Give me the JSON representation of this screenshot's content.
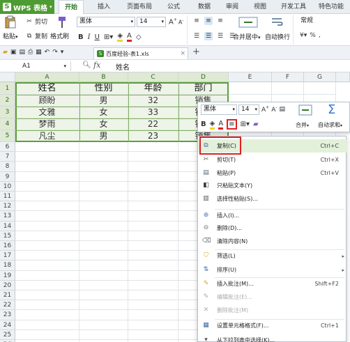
{
  "app": {
    "name": "WPS 表格",
    "logo_letter": "S"
  },
  "tabs": [
    "开始",
    "插入",
    "页面布局",
    "公式",
    "数据",
    "审阅",
    "视图",
    "开发工具",
    "特色功能"
  ],
  "active_tab": "开始",
  "ribbon": {
    "paste": "粘贴",
    "cut": "剪切",
    "copy": "复制",
    "format_painter": "格式刷",
    "font_name": "黑体",
    "font_size": "14",
    "merge": "合并居中",
    "wrap": "自动换行",
    "number_format": "常规",
    "percent": "%"
  },
  "doc_tab": "百度经验-表1.xls",
  "formula_bar": {
    "name_box": "A1",
    "fx": "fx",
    "value": "姓名"
  },
  "columns": [
    "A",
    "B",
    "C",
    "D",
    "E",
    "F",
    "G"
  ],
  "rows": [
    "1",
    "2",
    "3",
    "4",
    "5",
    "6",
    "7",
    "8",
    "9",
    "10",
    "11",
    "12",
    "13",
    "14",
    "15",
    "16",
    "17",
    "18",
    "19",
    "20",
    "21",
    "22",
    "23",
    "24",
    "25",
    "26"
  ],
  "table": {
    "headers": [
      "姓名",
      "性别",
      "年龄",
      "部门"
    ],
    "data": [
      [
        "顾盼",
        "男",
        "32",
        "销售"
      ],
      [
        "文雅",
        "女",
        "33",
        "销售"
      ],
      [
        "梦雨",
        "女",
        "22",
        "销售"
      ],
      [
        "凡尘",
        "男",
        "23",
        "销售"
      ]
    ]
  },
  "mini_toolbar": {
    "font_name": "黑体",
    "font_size": "14",
    "merge": "合并",
    "autosum": "自动求和"
  },
  "context_menu": [
    {
      "label": "复制(C)",
      "shortcut": "Ctrl+C",
      "highlight": true
    },
    {
      "label": "剪切(T)",
      "shortcut": "Ctrl+X"
    },
    {
      "label": "粘贴(P)",
      "shortcut": "Ctrl+V"
    },
    {
      "label": "只粘贴文本(Y)"
    },
    {
      "label": "选择性粘贴(S)..."
    },
    {
      "label": "插入(I)..."
    },
    {
      "label": "删除(D)..."
    },
    {
      "label": "清除内容(N)"
    },
    {
      "label": "筛选(L)",
      "submenu": true
    },
    {
      "label": "排序(U)",
      "submenu": true
    },
    {
      "label": "插入批注(M)...",
      "shortcut": "Shift+F2"
    },
    {
      "label": "编辑批注(E)...",
      "disabled": true
    },
    {
      "label": "删除批注(M)",
      "disabled": true
    },
    {
      "label": "设置单元格格式(F)...",
      "shortcut": "Ctrl+1"
    },
    {
      "label": "从下拉列表中选择(K)..."
    }
  ],
  "colors": {
    "accent": "#4e9a33",
    "selection_border": "#5c9e3c",
    "highlight_box": "#e02020"
  }
}
